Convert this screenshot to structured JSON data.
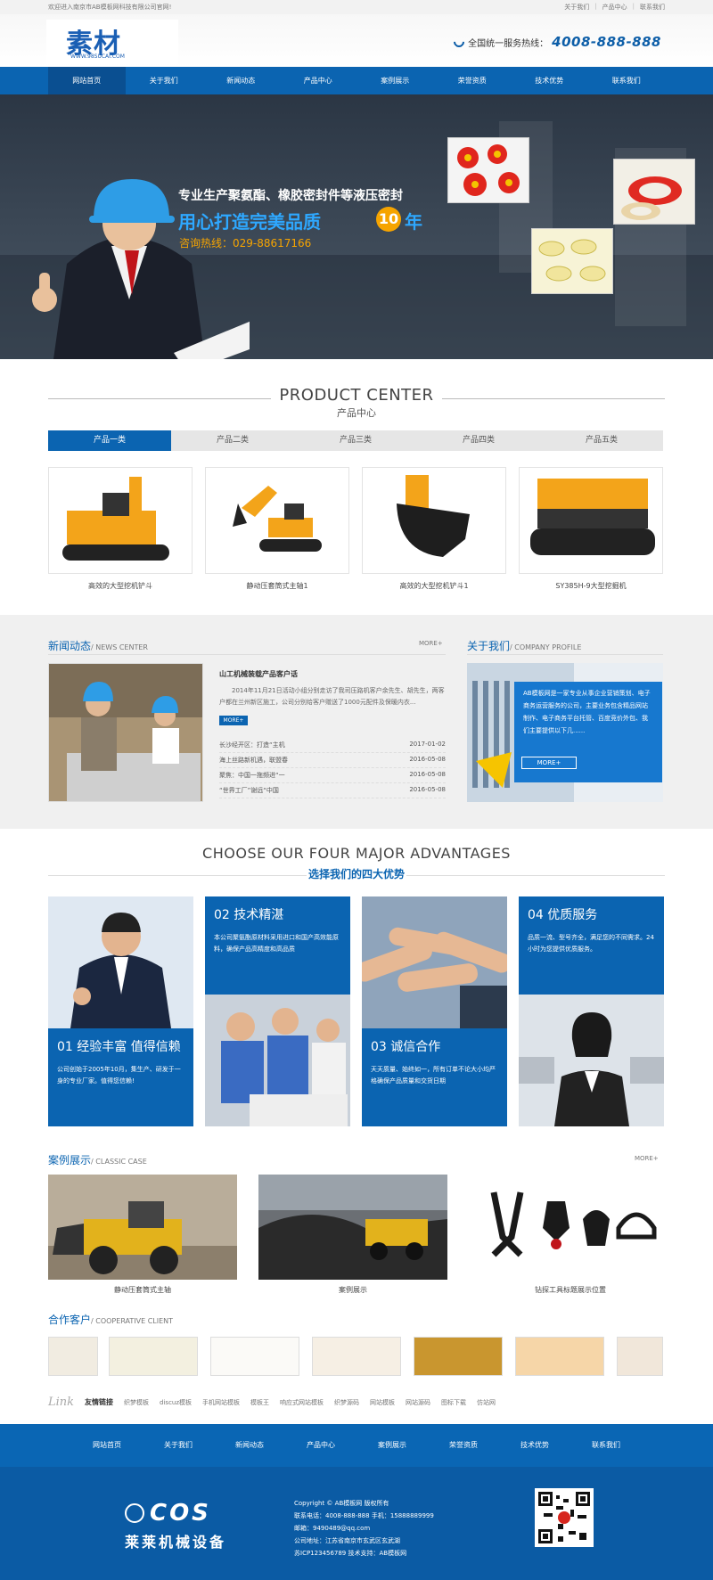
{
  "topbar": {
    "welcome": "欢迎进入南京市AB模板网科技有限公司官网!",
    "links": [
      "关于我们",
      "产品中心",
      "联系我们"
    ]
  },
  "header": {
    "logo_text": "素材",
    "logo_sub": "WWW.98SUCAI.COM",
    "hotline_label": "全国统一服务热线：",
    "hotline_number": "4008-888-888"
  },
  "nav": {
    "items": [
      "网站首页",
      "关于我们",
      "新闻动态",
      "产品中心",
      "案例展示",
      "荣誉资质",
      "技术优势",
      "联系我们"
    ]
  },
  "banner": {
    "line1": "专业生产聚氨酯、橡胶密封件等液压密封",
    "line2": "用心打造完美品质",
    "badge": "10",
    "line2_end": "年",
    "hotline": "咨询热线：029-88617166"
  },
  "products": {
    "title_en": "PRODUCT CENTER",
    "title_cn": "产品中心",
    "tabs": [
      "产品一类",
      "产品二类",
      "产品三类",
      "产品四类",
      "产品五类"
    ],
    "items": [
      "高效的大型挖机铲斗",
      "静动压套筒式主轴1",
      "高效的大型挖机铲斗1",
      "SY385H-9大型挖掘机"
    ]
  },
  "news": {
    "title": "新闻动态",
    "title_en": "/ NEWS CENTER",
    "more": "MORE+",
    "headline": "山工机械装载产品客户话",
    "summary": "2014年11月21日活动小组分别走访了我司压路机客户余先生、胡先生，两客户都在兰州新区施工，公司分别给客户赠送了1000元配件及保暖内衣...",
    "more_btn": "MORE+",
    "list": [
      {
        "title": "长沙经开区：打造“主机",
        "date": "2017-01-02"
      },
      {
        "title": "海上丝路新机遇，联盟春",
        "date": "2016-05-08"
      },
      {
        "title": "聚焦：中国一拖频进“一",
        "date": "2016-05-08"
      },
      {
        "title": "“世界工厂”谢远“中国",
        "date": "2016-05-08"
      }
    ]
  },
  "about": {
    "title": "关于我们",
    "title_en": "/ COMPANY PROFILE",
    "text": "AB模板网是一家专业从事企业营销策划、电子商务运营服务的公司，主要业务包含精品网站制作、电子商务平台托管、百度竞价外包、我们主要提供以下几......",
    "more_btn": "MORE+"
  },
  "advantages": {
    "title_en": "CHOOSE OUR FOUR MAJOR ADVANTAGES",
    "title_cn": "选择我们的四大优势",
    "items": [
      {
        "title": "01  经验丰富 值得信赖",
        "text": "公司创始于2005年10月，集生产、研发于一身的专业厂家。值得您信赖!"
      },
      {
        "title": "02  技术精湛",
        "text": "本公司聚氨酯原材料采用进口和国产高效能原料，确保产品高精度和高品质"
      },
      {
        "title": "03  诚信合作",
        "text": "天天质量、始终如一，所有订单不论大小均严格确保产品质量和交货日期"
      },
      {
        "title": "04  优质服务",
        "text": "品质一流、型号齐全，满足您的不同需求。24小时为您提供优质服务。"
      }
    ]
  },
  "cases": {
    "title": "案例展示",
    "title_en": "/ CLASSIC CASE",
    "more": "MORE+",
    "items": [
      "静动压套筒式主轴",
      "案例展示",
      "钻探工具标题展示位置"
    ]
  },
  "clients": {
    "title": "合作客户",
    "title_en": "/ COOPERATIVE CLIENT"
  },
  "links": {
    "link_word": "Link",
    "label": "友情链接",
    "items": [
      "织梦模板",
      "discuz模板",
      "手机网站模板",
      "模板王",
      "响应式网站模板",
      "织梦源码",
      "网站模板",
      "网站源码",
      "图标下载",
      "仿站网"
    ]
  },
  "footer": {
    "nav": [
      "网站首页",
      "关于我们",
      "新闻动态",
      "产品中心",
      "案例展示",
      "荣誉资质",
      "技术优势",
      "联系我们"
    ],
    "logo_en": "COS",
    "logo_cn": "莱莱机械设备",
    "copyright": "Copyright © AB模板网 版权所有",
    "phone": "联系电话：4008-888-888   手机：15888889999",
    "email": "邮箱：9490489@qq.com",
    "address": "公司地址：江苏省南京市玄武区玄武湖",
    "icp": "苏ICP123456789   技术支持：AB模板网"
  },
  "colors": {
    "primary": "#0b64b1",
    "accent": "#f6a400"
  }
}
